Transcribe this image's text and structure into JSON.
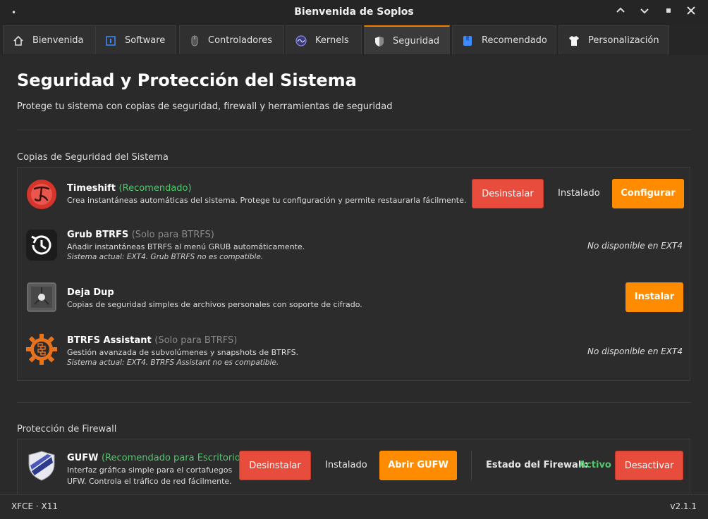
{
  "window": {
    "title": "Bienvenida de Soplos"
  },
  "tabs": [
    {
      "label": "Bienvenida",
      "icon": "home-icon"
    },
    {
      "label": "Software",
      "icon": "software-icon"
    },
    {
      "label": "Controladores",
      "icon": "mouse-icon"
    },
    {
      "label": "Kernels",
      "icon": "kernel-icon"
    },
    {
      "label": "Seguridad",
      "icon": "shield-icon",
      "active": true
    },
    {
      "label": "Recomendado",
      "icon": "bookmark-icon"
    },
    {
      "label": "Personalización",
      "icon": "shirt-icon"
    }
  ],
  "page": {
    "title": "Seguridad y Protección del Sistema",
    "subtitle": "Protege tu sistema con copias de seguridad, firewall y herramientas de seguridad"
  },
  "backup": {
    "section_title": "Copias de Seguridad del Sistema",
    "items": [
      {
        "name": "Timeshift",
        "tag": "(Recomendado)",
        "desc": "Crea instantáneas automáticas del sistema. Protege tu configuración y permite restaurarla fácilmente.",
        "uninstall": "Desinstalar",
        "status": "Instalado",
        "action": "Configurar"
      },
      {
        "name": "Grub BTRFS",
        "tag": "(Solo para BTRFS)",
        "desc": "Añadir instantáneas BTRFS al menú GRUB automáticamente.",
        "note": "Sistema actual: EXT4. Grub BTRFS no es compatible.",
        "availability": "No disponible en EXT4"
      },
      {
        "name": "Deja Dup",
        "desc": "Copias de seguridad simples de archivos personales con soporte de cifrado.",
        "action": "Instalar"
      },
      {
        "name": "BTRFS Assistant",
        "tag": "(Solo para BTRFS)",
        "desc": "Gestión avanzada de subvolúmenes y snapshots de BTRFS.",
        "note": "Sistema actual: EXT4. BTRFS Assistant no es compatible.",
        "availability": "No disponible en EXT4"
      }
    ]
  },
  "firewall": {
    "section_title": "Protección de Firewall",
    "item": {
      "name": "GUFW",
      "tag": "(Recomendado para Escritorio)",
      "desc1": "Interfaz gráfica simple para el cortafuegos",
      "desc2": "UFW. Controla el tráfico de red fácilmente.",
      "uninstall": "Desinstalar",
      "status": "Instalado",
      "action": "Abrir GUFW",
      "state_label": "Estado del Firewall:",
      "state_value": "Activo",
      "toggle": "Desactivar"
    }
  },
  "statusbar": {
    "session": "XFCE · X11",
    "version": "v2.1.1"
  },
  "colors": {
    "accent": "#ff8c00",
    "danger": "#e74c3c",
    "ok": "#4fc96b"
  }
}
